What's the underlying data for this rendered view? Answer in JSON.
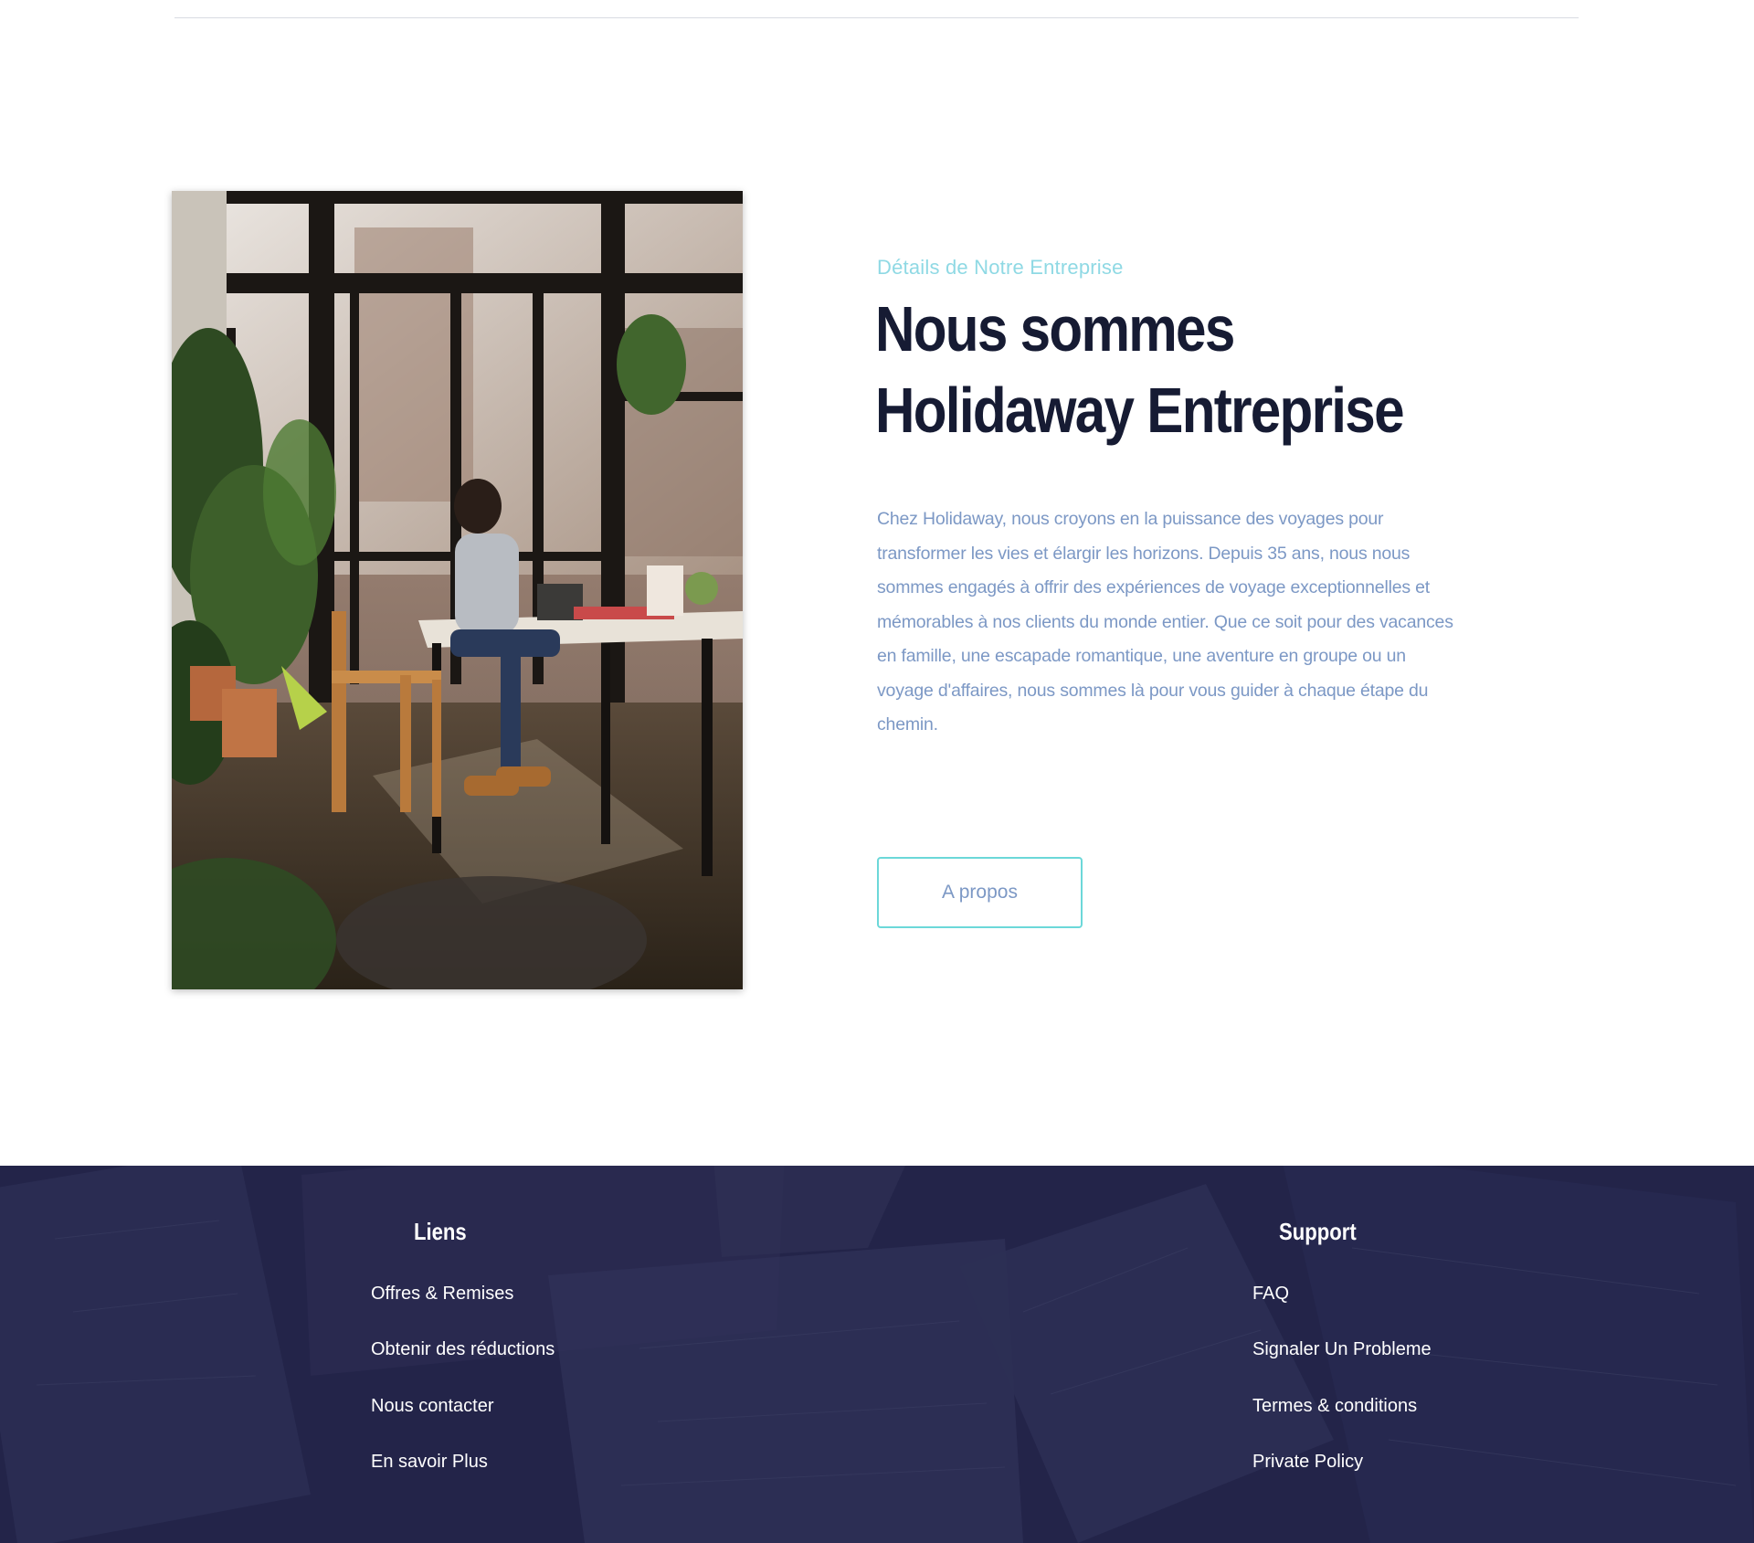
{
  "about": {
    "eyebrow": "Détails de Notre Entreprise",
    "headline_line1": "Nous sommes",
    "headline_line2": "Holidaway Entreprise",
    "body": "Chez Holidaway, nous croyons en la puissance des voyages pour transformer les vies et élargir les horizons. Depuis 35 ans, nous nous sommes engagés à offrir des expériences de voyage exceptionnelles et mémorables à nos clients du monde entier. Que ce soit pour des vacances en famille, une escapade romantique, une aventure en groupe ou un voyage d'affaires, nous sommes là pour vous guider à chaque étape du chemin.",
    "button_label": "A propos"
  },
  "footer": {
    "links": {
      "title": "Liens",
      "items": [
        "Offres & Remises",
        "Obtenir des réductions",
        "Nous contacter",
        "En savoir Plus"
      ]
    },
    "support": {
      "title": "Support",
      "items": [
        "FAQ",
        "Signaler Un Probleme",
        "Termes & conditions",
        "Private Policy"
      ]
    }
  },
  "colors": {
    "eyebrow": "#8fd9e4",
    "headline": "#161b33",
    "body": "#7c98c5",
    "button_border": "#6cd8d9",
    "footer_bg": "#232449"
  }
}
